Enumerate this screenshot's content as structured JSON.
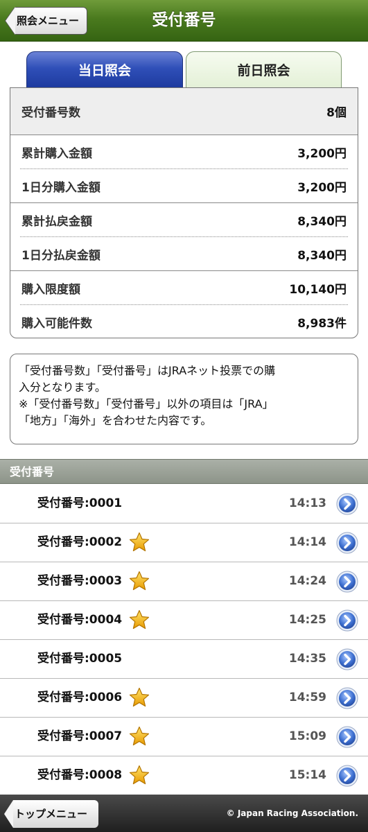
{
  "header": {
    "title": "受付番号",
    "back_label": "照会メニュー"
  },
  "tabs": [
    {
      "label": "当日照会",
      "active": true
    },
    {
      "label": "前日照会",
      "active": false
    }
  ],
  "summary": {
    "rows": [
      {
        "label": "受付番号数",
        "value": "8個"
      },
      {
        "label": "累計購入金額",
        "value": "3,200円"
      },
      {
        "label": "1日分購入金額",
        "value": "3,200円"
      },
      {
        "label": "累計払戻金額",
        "value": "8,340円"
      },
      {
        "label": "1日分払戻金額",
        "value": "8,340円"
      },
      {
        "label": "購入限度額",
        "value": "10,140円"
      },
      {
        "label": "購入可能件数",
        "value": "8,983件"
      }
    ]
  },
  "notice": {
    "line1": "「受付番号数」「受付番号」はJRAネット投票での購",
    "line2": "入分となります。",
    "line3": "※「受付番号数」「受付番号」以外の項目は「JRA」",
    "line4": "「地方」「海外」を合わせた内容です。"
  },
  "list": {
    "header": "受付番号",
    "items": [
      {
        "label": "受付番号:0001",
        "time": "14:13",
        "starred": false
      },
      {
        "label": "受付番号:0002",
        "time": "14:14",
        "starred": true
      },
      {
        "label": "受付番号:0003",
        "time": "14:24",
        "starred": true
      },
      {
        "label": "受付番号:0004",
        "time": "14:25",
        "starred": true
      },
      {
        "label": "受付番号:0005",
        "time": "14:35",
        "starred": false
      },
      {
        "label": "受付番号:0006",
        "time": "14:59",
        "starred": true
      },
      {
        "label": "受付番号:0007",
        "time": "15:09",
        "starred": true
      },
      {
        "label": "受付番号:0008",
        "time": "15:14",
        "starred": true
      }
    ]
  },
  "footer": {
    "top_menu_label": "トップメニュー",
    "copyright": "© Japan Racing Association."
  },
  "colors": {
    "header_green": "#4a7a1e",
    "tab_active_blue": "#2f4fb8",
    "star_gold": "#f5b400",
    "go_button_blue": "#3d6fd0"
  },
  "icons": {
    "star": "star-icon",
    "go": "chevron-right-circle-icon",
    "back": "back-arrow-icon"
  }
}
